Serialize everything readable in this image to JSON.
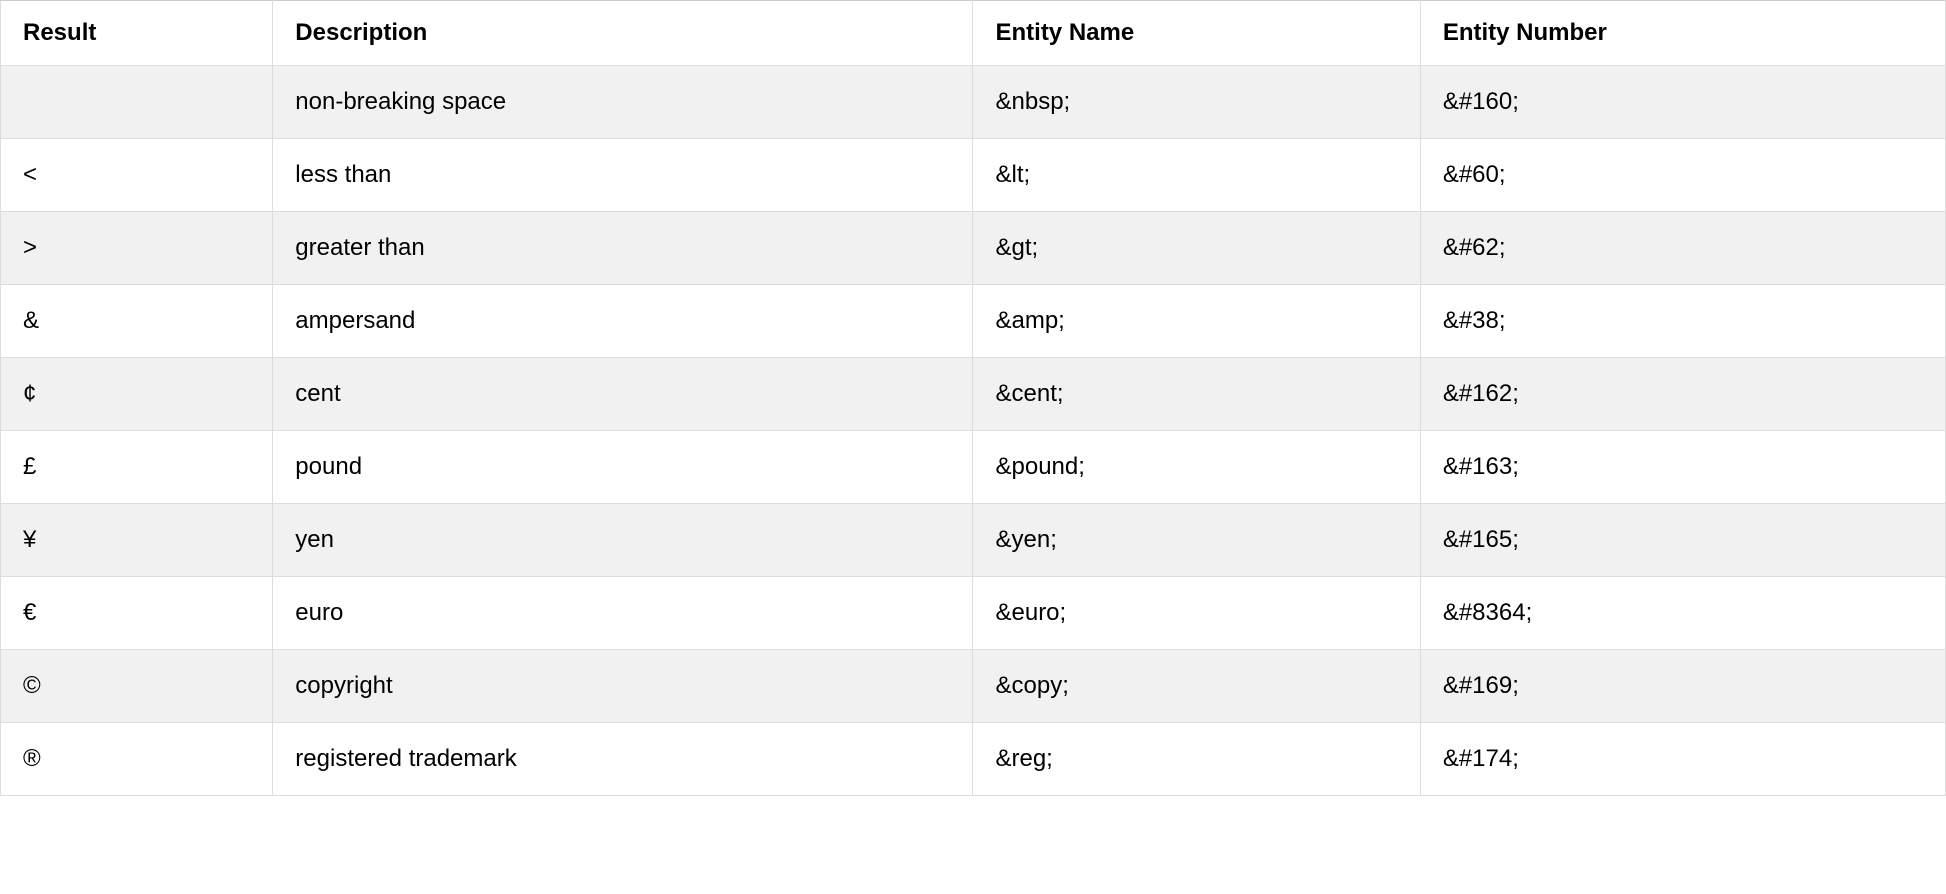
{
  "table": {
    "headers": [
      "Result",
      "Description",
      "Entity Name",
      "Entity Number"
    ],
    "rows": [
      {
        "result": " ",
        "description": "non-breaking space",
        "entity_name": "&nbsp;",
        "entity_number": "&#160;"
      },
      {
        "result": "<",
        "description": "less than",
        "entity_name": "&lt;",
        "entity_number": "&#60;"
      },
      {
        "result": ">",
        "description": "greater than",
        "entity_name": "&gt;",
        "entity_number": "&#62;"
      },
      {
        "result": "&",
        "description": "ampersand",
        "entity_name": "&amp;",
        "entity_number": "&#38;"
      },
      {
        "result": "¢",
        "description": "cent",
        "entity_name": "&cent;",
        "entity_number": "&#162;"
      },
      {
        "result": "£",
        "description": "pound",
        "entity_name": "&pound;",
        "entity_number": "&#163;"
      },
      {
        "result": "¥",
        "description": "yen",
        "entity_name": "&yen;",
        "entity_number": "&#165;"
      },
      {
        "result": "€",
        "description": "euro",
        "entity_name": "&euro;",
        "entity_number": "&#8364;"
      },
      {
        "result": "©",
        "description": "copyright",
        "entity_name": "&copy;",
        "entity_number": "&#169;"
      },
      {
        "result": "®",
        "description": "registered trademark",
        "entity_name": "&reg;",
        "entity_number": "&#174;"
      }
    ]
  }
}
